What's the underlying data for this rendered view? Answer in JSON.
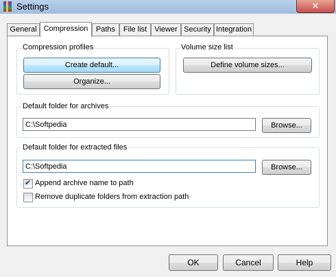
{
  "window": {
    "title": "Settings",
    "close_glyph": "✕"
  },
  "tabs": [
    {
      "label": "General"
    },
    {
      "label": "Compression"
    },
    {
      "label": "Paths"
    },
    {
      "label": "File list"
    },
    {
      "label": "Viewer"
    },
    {
      "label": "Security"
    },
    {
      "label": "Integration"
    }
  ],
  "active_tab": "Compression",
  "compression_profiles": {
    "label": "Compression profiles",
    "create_default": "Create default...",
    "organize": "Organize..."
  },
  "volume_size_list": {
    "label": "Volume size list",
    "define": "Define volume sizes..."
  },
  "archives_folder": {
    "label": "Default folder for archives",
    "value": "C:\\Softpedia",
    "browse": "Browse..."
  },
  "extracted_folder": {
    "label": "Default folder for extracted files",
    "value": "C:\\Softpedia",
    "browse": "Browse...",
    "append_name": {
      "label": "Append archive name to path",
      "checked": true
    },
    "remove_duplicates": {
      "label": "Remove duplicate folders from extraction path",
      "checked": false
    }
  },
  "footer": {
    "ok": "OK",
    "cancel": "Cancel",
    "help": "Help"
  },
  "colors": {
    "titlebar": "#b9d1ea",
    "close": "#c75050",
    "hot_button": "#bee6fd"
  }
}
